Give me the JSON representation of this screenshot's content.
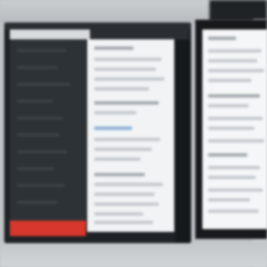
{
  "scene": {
    "description_colors": {
      "background": "#bfc3c6",
      "monitor_frame": "#1e2226",
      "sidebar": "#2d3236",
      "accent_bar": "#d8372d",
      "document": "#f1f3f4",
      "link_text": "#8fb4d6"
    }
  },
  "left_monitor": {
    "sidebar_items": 10,
    "document_lines": 18
  },
  "right_monitor": {
    "document_lines": 16
  }
}
